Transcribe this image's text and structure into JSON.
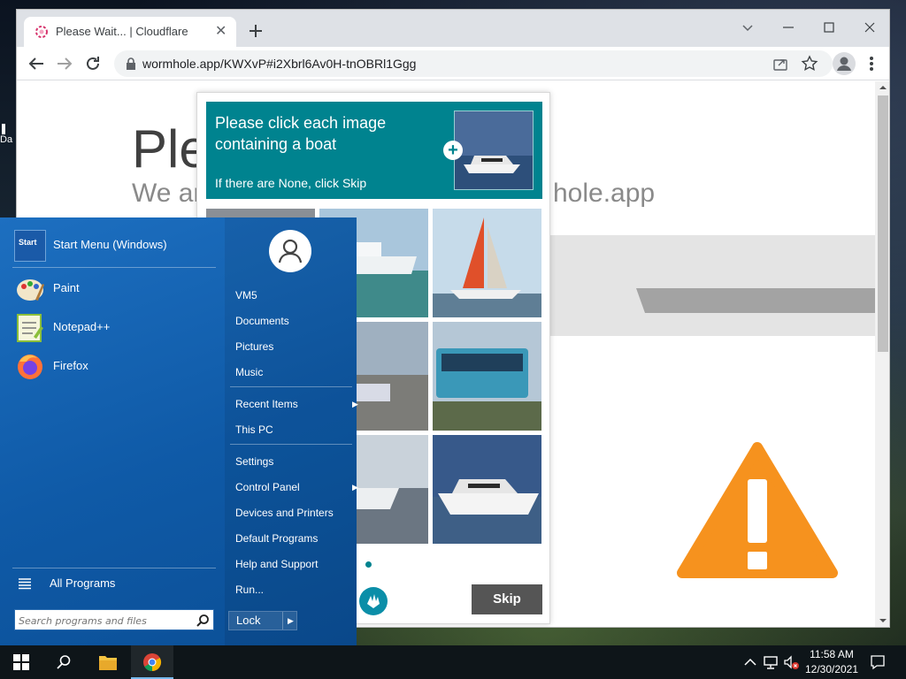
{
  "desktop": {
    "sliver_text": "Da"
  },
  "browser": {
    "tab_title": "Please Wait... | Cloudflare",
    "url": "wormhole.app/KWXvP#i2Xbrl6Av0H-tnOBRl1Ggg"
  },
  "page": {
    "heading": "Ple",
    "subheading": "We ar",
    "subheading_end": "hole.app"
  },
  "captcha": {
    "prompt": "Please click each image containing a boat",
    "hint": "If there are None, click Skip",
    "skip_label": "Skip"
  },
  "start_menu": {
    "programs": [
      {
        "label": "Start Menu (Windows)",
        "icon": "start-menu-icon"
      },
      {
        "label": "Paint",
        "icon": "paint-icon"
      },
      {
        "label": "Notepad++",
        "icon": "notepad-plus-plus-icon"
      },
      {
        "label": "Firefox",
        "icon": "firefox-icon"
      }
    ],
    "all_programs": "All Programs",
    "search_placeholder": "Search programs and files",
    "user": "VM5",
    "links": {
      "documents": "Documents",
      "pictures": "Pictures",
      "music": "Music",
      "recent_items": "Recent Items",
      "this_pc": "This PC",
      "settings": "Settings",
      "control_panel": "Control Panel",
      "devices_printers": "Devices and Printers",
      "default_programs": "Default Programs",
      "help_support": "Help and Support",
      "run": "Run..."
    },
    "lock": "Lock",
    "start_icon_text": "Start"
  },
  "taskbar": {
    "time": "11:58 AM",
    "date": "12/30/2021"
  },
  "colors": {
    "captcha_teal": "#00838f",
    "warning_orange": "#f6921e",
    "startmenu_blue": "#1d6fc0"
  }
}
